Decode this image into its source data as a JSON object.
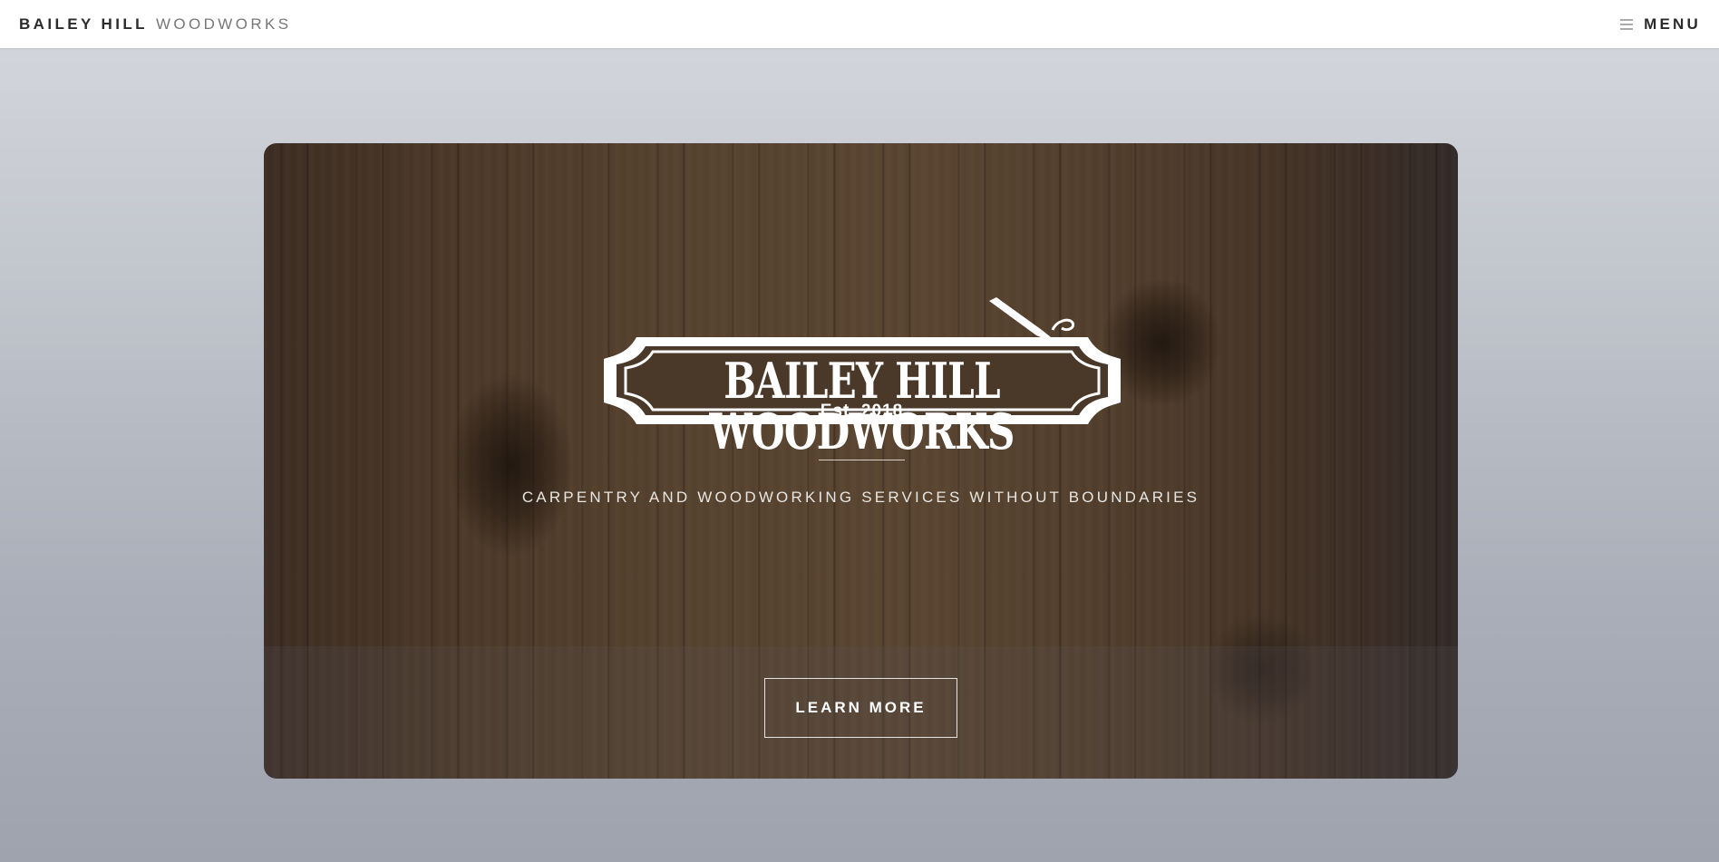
{
  "header": {
    "brand_strong": "BAILEY HILL",
    "brand_light": "WOODWORKS",
    "menu_label": "MENU",
    "menu_icon": "hamburger-icon"
  },
  "hero": {
    "logo_title": "BAILEY HILL WOODWORKS",
    "logo_est": "Est. 2018",
    "logo_icon": "chisel-icon",
    "tagline": "CARPENTRY AND WOODWORKING SERVICES WITHOUT BOUNDARIES",
    "cta_label": "LEARN MORE"
  },
  "colors": {
    "header_bg": "#ffffff",
    "brand_text": "#2b2b2b",
    "page_bg_top": "#d5d8dd",
    "page_bg_bottom": "#9ea3ae",
    "wood_dark": "#3a2c24",
    "wood_mid": "#5a4632",
    "hero_text": "#ffffff"
  }
}
